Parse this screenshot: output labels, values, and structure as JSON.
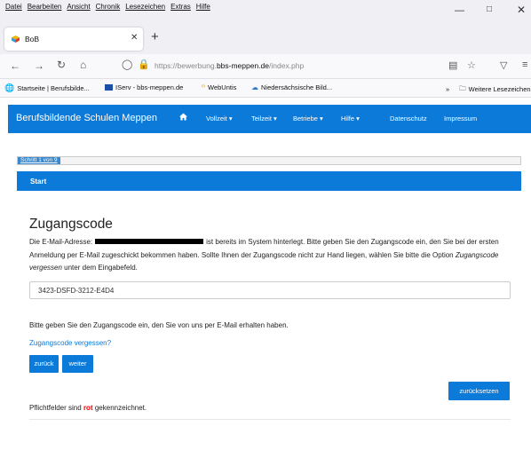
{
  "browser": {
    "menu": [
      "Datei",
      "Bearbeiten",
      "Ansicht",
      "Chronik",
      "Lesezeichen",
      "Extras",
      "Hilfe"
    ],
    "tab_title": "BoB",
    "url_prefix": "https://bewerbung.",
    "url_domain": "bbs-meppen.de",
    "url_path": "/index.php",
    "bookmarks": [
      "Startseite | Berufsbilde...",
      "IServ - bbs-meppen.de",
      "WebUntis",
      "Niedersächsische Bild..."
    ],
    "bookmarks_more": "Weitere Lesezeichen"
  },
  "site": {
    "brand": "Berufsbildende Schulen Meppen",
    "nav": [
      "Vollzeit ▾",
      "Teilzeit ▾",
      "Betriebe ▾",
      "Hilfe ▾",
      "Datenschutz",
      "Impressum"
    ]
  },
  "page": {
    "step": "Schritt 1 von 9",
    "section": "Start",
    "heading": "Zugangscode",
    "para_a": "Die E-Mail-Adresse:",
    "para_b": "ist bereits im System hinterlegt. Bitte geben Sie den Zugangscode ein, den Sie bei der ersten Anmeldung per E-Mail zugeschickt bekommen haben. Sollte Ihnen der Zugangscode nicht zur Hand liegen, wählen Sie bitte die Option",
    "para_option": "Zugangscode vergessen",
    "para_c": "unter dem Eingabefeld.",
    "code_value": "3423-DSFD-3212-E4D4",
    "hint": "Bitte geben Sie den Zugangscode ein, den Sie von uns per E-Mail erhalten haben.",
    "forgot_link": "Zugangscode vergessen?",
    "btn_back": "zurück",
    "btn_next": "weiter",
    "btn_reset": "zurücksetzen",
    "required_pre": "Pflichtfelder sind",
    "required_red": "rot",
    "required_post": "gekennzeichnet."
  },
  "colors": {
    "primary": "#0b7ad9",
    "required": "#ee0000"
  }
}
